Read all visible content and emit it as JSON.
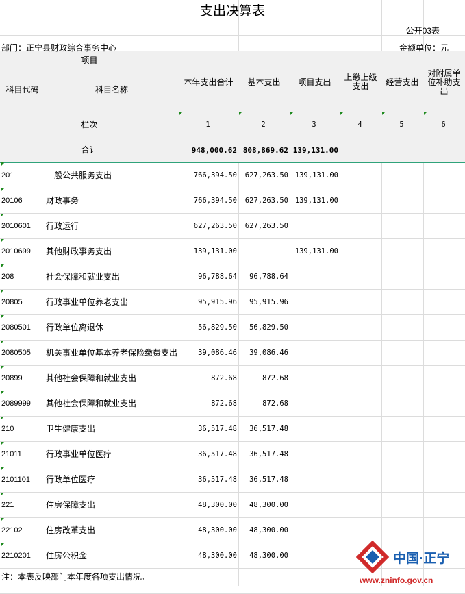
{
  "title": "支出决算表",
  "table_no": "公开03表",
  "department": "部门：正宁县财政综合事务中心",
  "unit": "金额单位：元",
  "header": {
    "project": "项目",
    "code": "科目代码",
    "name": "科目名称",
    "columns": [
      "本年支出合计",
      "基本支出",
      "项目支出",
      "上缴上级支出",
      "经营支出",
      "对附属单位补助支出"
    ],
    "index_label": "栏次",
    "index_numbers": [
      "1",
      "2",
      "3",
      "4",
      "5",
      "6"
    ]
  },
  "total": {
    "label": "合计",
    "values": [
      "948,000.62",
      "808,869.62",
      "139,131.00",
      "",
      "",
      ""
    ]
  },
  "rows": [
    {
      "code": "201",
      "name": "一般公共服务支出",
      "values": [
        "766,394.50",
        "627,263.50",
        "139,131.00"
      ]
    },
    {
      "code": "20106",
      "name": "财政事务",
      "values": [
        "766,394.50",
        "627,263.50",
        "139,131.00"
      ]
    },
    {
      "code": "2010601",
      "name": "行政运行",
      "values": [
        "627,263.50",
        "627,263.50",
        ""
      ]
    },
    {
      "code": "2010699",
      "name": "其他财政事务支出",
      "values": [
        "139,131.00",
        "",
        "139,131.00"
      ]
    },
    {
      "code": "208",
      "name": "社会保障和就业支出",
      "values": [
        "96,788.64",
        "96,788.64",
        ""
      ]
    },
    {
      "code": "20805",
      "name": "行政事业单位养老支出",
      "values": [
        "95,915.96",
        "95,915.96",
        ""
      ]
    },
    {
      "code": "2080501",
      "name": "行政单位离退休",
      "values": [
        "56,829.50",
        "56,829.50",
        ""
      ]
    },
    {
      "code": "2080505",
      "name": "机关事业单位基本养老保险缴费支出",
      "values": [
        "39,086.46",
        "39,086.46",
        ""
      ]
    },
    {
      "code": "20899",
      "name": "其他社会保障和就业支出",
      "values": [
        "872.68",
        "872.68",
        ""
      ]
    },
    {
      "code": "2089999",
      "name": "其他社会保障和就业支出",
      "values": [
        "872.68",
        "872.68",
        ""
      ]
    },
    {
      "code": "210",
      "name": "卫生健康支出",
      "values": [
        "36,517.48",
        "36,517.48",
        ""
      ]
    },
    {
      "code": "21011",
      "name": "行政事业单位医疗",
      "values": [
        "36,517.48",
        "36,517.48",
        ""
      ]
    },
    {
      "code": "2101101",
      "name": "行政单位医疗",
      "values": [
        "36,517.48",
        "36,517.48",
        ""
      ]
    },
    {
      "code": "221",
      "name": "住房保障支出",
      "values": [
        "48,300.00",
        "48,300.00",
        ""
      ]
    },
    {
      "code": "22102",
      "name": "住房改革支出",
      "values": [
        "48,300.00",
        "48,300.00",
        ""
      ]
    },
    {
      "code": "2210201",
      "name": "住房公积金",
      "values": [
        "48,300.00",
        "48,300.00",
        ""
      ]
    }
  ],
  "note": "注：本表反映部门本年度各项支出情况。",
  "watermark": {
    "brand": "中国·正宁",
    "url": "www.zninfo.gov.cn",
    "colors": {
      "red": "#d02a2a",
      "blue": "#1a5fb0"
    }
  }
}
